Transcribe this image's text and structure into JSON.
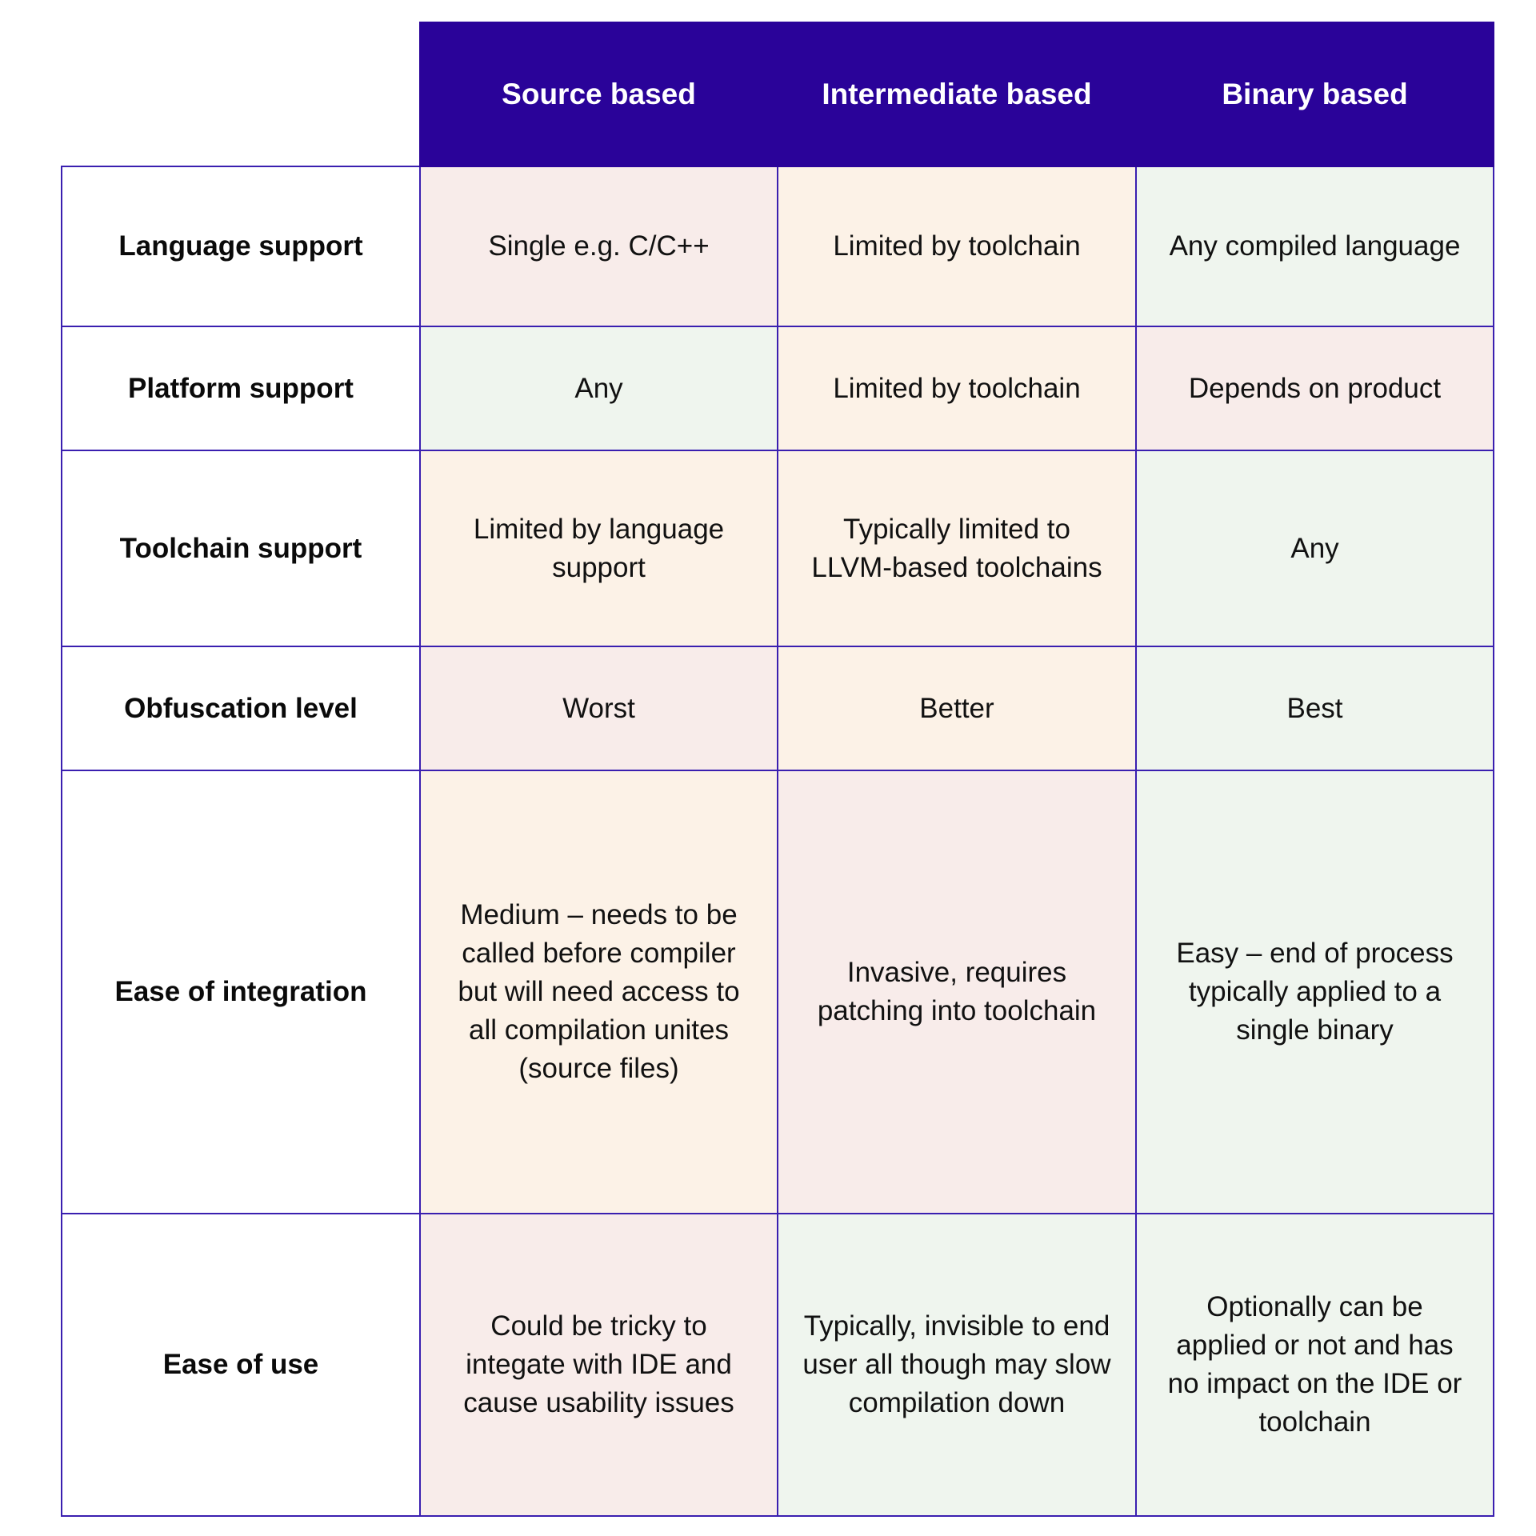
{
  "table": {
    "columns": [
      "Source based",
      "Intermediate based",
      "Binary based"
    ],
    "rows": [
      {
        "label": "Language support",
        "cells": [
          {
            "text": "Single e.g. C/C++",
            "rating": "pink"
          },
          {
            "text": "Limited by toolchain",
            "rating": "peach"
          },
          {
            "text": "Any compiled language",
            "rating": "green"
          }
        ]
      },
      {
        "label": "Platform support",
        "cells": [
          {
            "text": "Any",
            "rating": "green"
          },
          {
            "text": "Limited by toolchain",
            "rating": "peach"
          },
          {
            "text": "Depends on product",
            "rating": "pink"
          }
        ]
      },
      {
        "label": "Toolchain support",
        "cells": [
          {
            "text": "Limited by language support",
            "rating": "peach"
          },
          {
            "text": "Typically limited to LLVM-based toolchains",
            "rating": "peach"
          },
          {
            "text": "Any",
            "rating": "green"
          }
        ]
      },
      {
        "label": "Obfuscation level",
        "cells": [
          {
            "text": "Worst",
            "rating": "pink"
          },
          {
            "text": "Better",
            "rating": "peach"
          },
          {
            "text": "Best",
            "rating": "green"
          }
        ]
      },
      {
        "label": "Ease of integration",
        "cells": [
          {
            "text": "Medium – needs to be called before compiler but will need access to all compilation unites (source files)",
            "rating": "peach"
          },
          {
            "text": "Invasive, requires patching into toolchain",
            "rating": "pink"
          },
          {
            "text": "Easy – end of process typically applied to a single binary",
            "rating": "green"
          }
        ]
      },
      {
        "label": "Ease of use",
        "cells": [
          {
            "text": "Could be tricky to integate with IDE and cause usability issues",
            "rating": "pink"
          },
          {
            "text": "Typically, invisible to end user all though may slow compilation down",
            "rating": "green"
          },
          {
            "text": "Optionally can be applied or not and has no impact on the IDE or toolchain",
            "rating": "green"
          }
        ]
      }
    ]
  },
  "colors": {
    "header_bg": "#2a0399",
    "border": "#3a1fb0",
    "pink": "#f8ecea",
    "peach": "#fcf2e7",
    "green": "#eff5ee"
  }
}
